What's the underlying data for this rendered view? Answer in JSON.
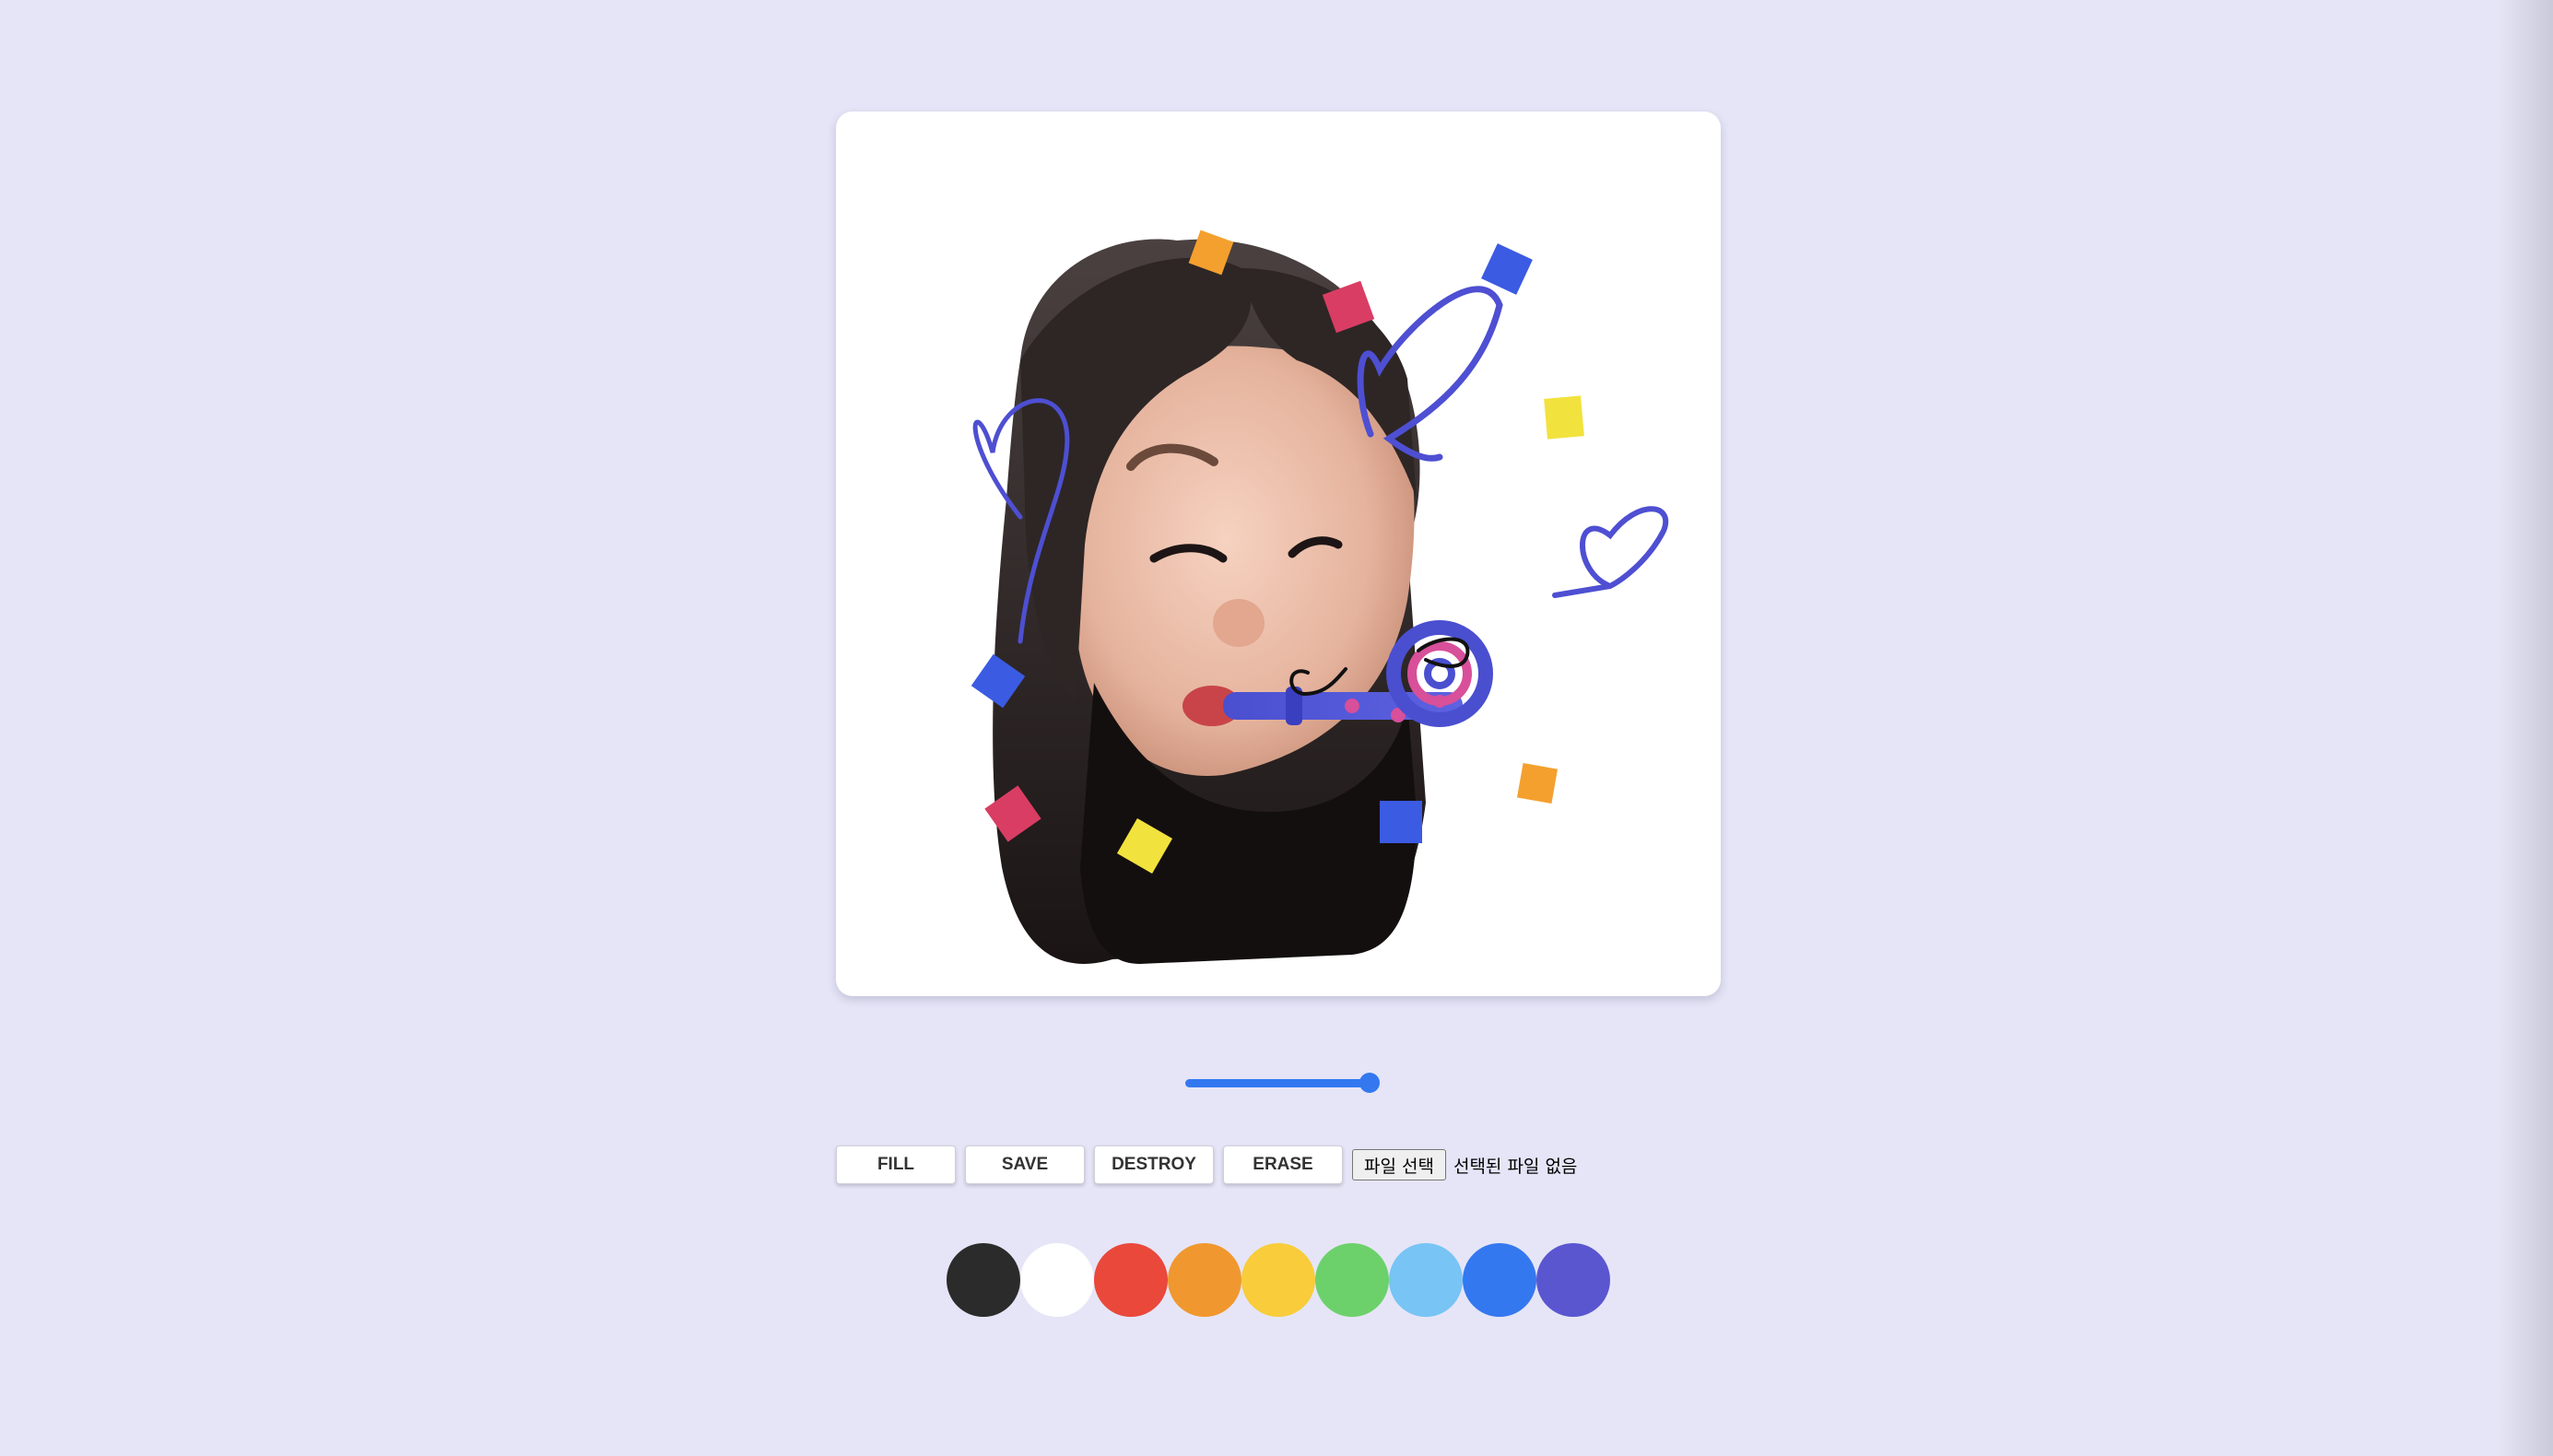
{
  "toolbar": {
    "fill_label": "FILL",
    "save_label": "SAVE",
    "destroy_label": "DESTROY",
    "erase_label": "ERASE"
  },
  "file_input": {
    "button_label": "파일 선택",
    "status_text": "선택된 파일 없음"
  },
  "line_width_slider": {
    "value_fraction": 1.0
  },
  "palette": {
    "colors": [
      "#2b2b2b",
      "#ffffff",
      "#e9483b",
      "#f0982f",
      "#f8cc3a",
      "#6dd16b",
      "#77c4f5",
      "#3478f0",
      "#5a56d0"
    ]
  },
  "canvas": {
    "image": "memoji-party-blower-icon"
  }
}
